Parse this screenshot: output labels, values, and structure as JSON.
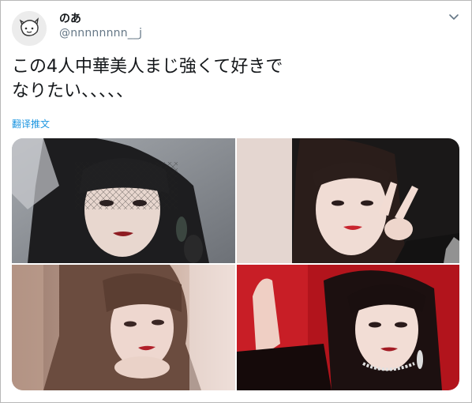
{
  "user": {
    "display_name": "のあ",
    "handle": "@nnnnnnnn__j",
    "avatar_icon": "sketch-face-avatar"
  },
  "tweet": {
    "lines": [
      "この4人中華美人まじ強くて好きで",
      "なりたい、、、、、"
    ],
    "translate_label": "翻译推文"
  },
  "menu_icon": "chevron-down-icon",
  "media": {
    "photos": [
      {
        "name": "photo-1",
        "desc_icon": "woman-portrait-net-veil"
      },
      {
        "name": "photo-2",
        "desc_icon": "woman-portrait-peace-sign"
      },
      {
        "name": "photo-3",
        "desc_icon": "woman-portrait-soft-light"
      },
      {
        "name": "photo-4",
        "desc_icon": "woman-portrait-red-background"
      }
    ]
  },
  "colors": {
    "link": "#1b95e0",
    "secondary_text": "#657786",
    "primary_text": "#14171a"
  }
}
